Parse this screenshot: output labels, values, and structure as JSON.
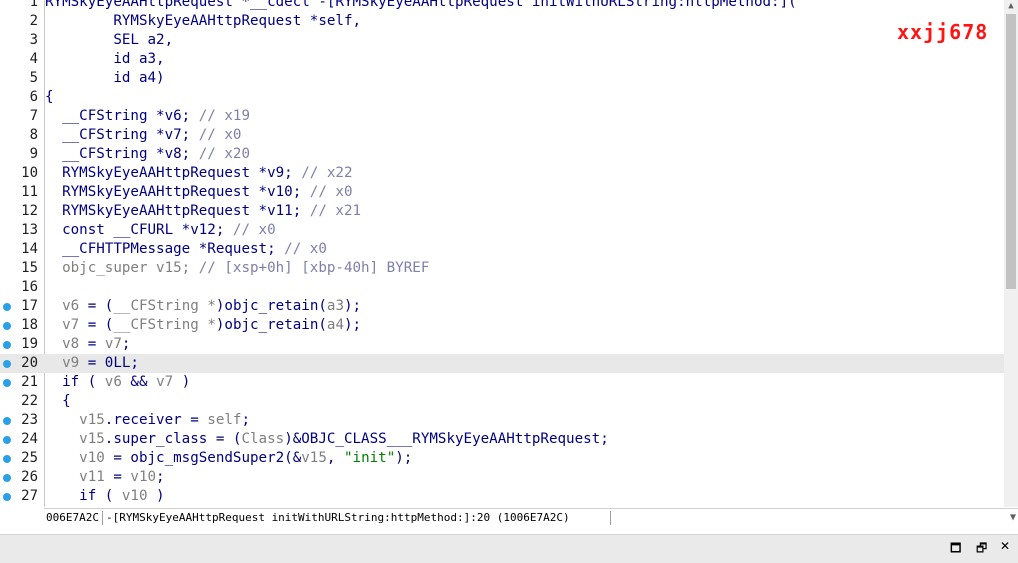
{
  "watermark": "xxjj678",
  "highlighted_line": 20,
  "lines": [
    {
      "n": "1",
      "bp": false,
      "html": "RYMSkyEyeAAHttpRequest *__cdecl -[RYMSkyEyeAAHttpRequest initWithURLString:httpMethod:]("
    },
    {
      "n": "2",
      "bp": false,
      "html": "        RYMSkyEyeAAHttpRequest *self,"
    },
    {
      "n": "3",
      "bp": false,
      "html": "        SEL a2,"
    },
    {
      "n": "4",
      "bp": false,
      "html": "        id a3,"
    },
    {
      "n": "5",
      "bp": false,
      "html": "        id a4)"
    },
    {
      "n": "6",
      "bp": false,
      "html": "{"
    },
    {
      "n": "7",
      "bp": false,
      "html": "  __CFString *v6; <span class=\"c\">// x19</span>"
    },
    {
      "n": "8",
      "bp": false,
      "html": "  __CFString *v7; <span class=\"c\">// x0</span>"
    },
    {
      "n": "9",
      "bp": false,
      "html": "  __CFString *v8; <span class=\"c\">// x20</span>"
    },
    {
      "n": "10",
      "bp": false,
      "html": "  RYMSkyEyeAAHttpRequest *v9; <span class=\"c\">// x22</span>"
    },
    {
      "n": "11",
      "bp": false,
      "html": "  RYMSkyEyeAAHttpRequest *v10; <span class=\"c\">// x0</span>"
    },
    {
      "n": "12",
      "bp": false,
      "html": "  RYMSkyEyeAAHttpRequest *v11; <span class=\"c\">// x21</span>"
    },
    {
      "n": "13",
      "bp": false,
      "html": "  const __CFURL *v12; <span class=\"c\">// x0</span>"
    },
    {
      "n": "14",
      "bp": false,
      "html": "  __CFHTTPMessage *Request; <span class=\"c\">// x0</span>"
    },
    {
      "n": "15",
      "bp": false,
      "html": "  <span class=\"g\">objc_super v15;</span> <span class=\"c\">// [xsp+0h] [xbp-40h] BYREF</span>"
    },
    {
      "n": "16",
      "bp": false,
      "html": ""
    },
    {
      "n": "17",
      "bp": true,
      "html": "  <span class=\"g\">v6</span> = (<span class=\"g\">__CFString *</span>)objc_retain(<span class=\"g\">a3</span>);"
    },
    {
      "n": "18",
      "bp": true,
      "html": "  <span class=\"g\">v7</span> = (<span class=\"g\">__CFString *</span>)objc_retain(<span class=\"g\">a4</span>);"
    },
    {
      "n": "19",
      "bp": true,
      "html": "  <span class=\"g\">v8</span> = <span class=\"g\">v7</span>;"
    },
    {
      "n": "20",
      "bp": true,
      "html": "  <span class=\"g\">v9</span> = 0LL;"
    },
    {
      "n": "21",
      "bp": true,
      "html": "  if ( <span class=\"g\">v6</span> &amp;&amp; <span class=\"g\">v7</span> )"
    },
    {
      "n": "22",
      "bp": false,
      "html": "  {"
    },
    {
      "n": "23",
      "bp": true,
      "html": "    <span class=\"g\">v15</span>.receiver = <span class=\"g\">self</span>;"
    },
    {
      "n": "24",
      "bp": true,
      "html": "    <span class=\"g\">v15</span>.super_class = (<span class=\"g\">Class</span>)&amp;OBJC_CLASS___RYMSkyEyeAAHttpRequest;"
    },
    {
      "n": "25",
      "bp": true,
      "html": "    <span class=\"g\">v10</span> = objc_msgSendSuper2(&amp;<span class=\"g\">v15</span>, <span class=\"s\">\"init\"</span>);"
    },
    {
      "n": "26",
      "bp": true,
      "html": "    <span class=\"g\">v11</span> = <span class=\"g\">v10</span>;"
    },
    {
      "n": "27",
      "bp": true,
      "html": "    if ( <span class=\"g\">v10</span> )"
    }
  ],
  "status": {
    "address": "006E7A2C",
    "location": "-[RYMSkyEyeAAHttpRequest initWithURLString:httpMethod:]:20 (1006E7A2C)"
  },
  "window_buttons": [
    "maximize-icon",
    "restore-icon",
    "close-icon"
  ]
}
